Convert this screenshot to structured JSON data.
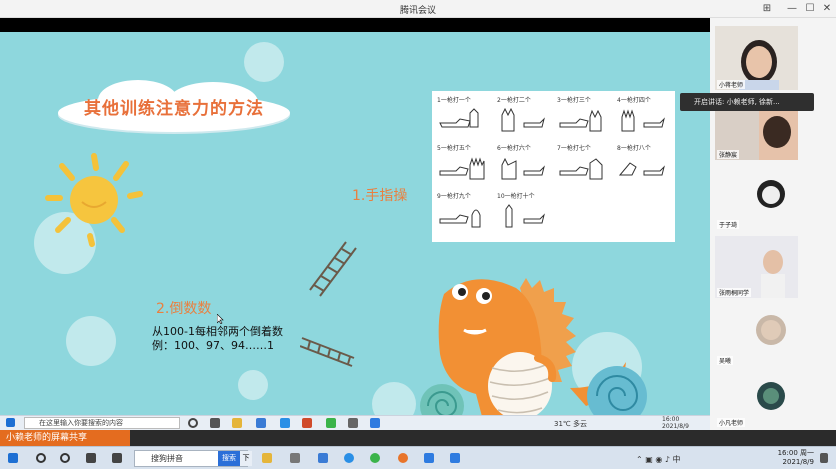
{
  "window": {
    "title": "腾讯会议"
  },
  "slide": {
    "title": "其他训练注意力的方法",
    "section1": "1.手指操",
    "section2": "2.倒数数",
    "note_line1": "从100-1每相邻两个倒着数",
    "note_line2": "例：100、97、94……1"
  },
  "finger_chart": {
    "cells": [
      "1一枪打一个",
      "2一枪打二个",
      "3一枪打三个",
      "4一枪打四个",
      "5一枪打五个",
      "6一枪打六个",
      "7一枪打七个",
      "8一枪打八个",
      "9一枪打九个",
      "10一枪打十个"
    ]
  },
  "participants": [
    {
      "name": "小蒋老师"
    },
    {
      "name": "张静宸"
    },
    {
      "name": "于子琦"
    },
    {
      "name": "张雨桐同学"
    },
    {
      "name": "吴曦"
    },
    {
      "name": "小凡老师"
    }
  ],
  "chat_popup": "开启讲话: 小赖老师, 徐新...",
  "inner_taskbar": {
    "search_placeholder": "在这里输入你要搜索的内容",
    "weather": "31℃ 多云",
    "time": "16:00",
    "date": "2021/8/9"
  },
  "share_banner": "小赖老师的屏幕共享",
  "taskbar": {
    "search_text": "搜狗拼音",
    "input_btn": "搜索",
    "down": "下",
    "time": "16:00 周一",
    "date": "2021/8/9"
  },
  "colors": {
    "accent": "#e46c1f",
    "slide_bg": "#8ed7dd",
    "title_orange": "#e8703a"
  }
}
